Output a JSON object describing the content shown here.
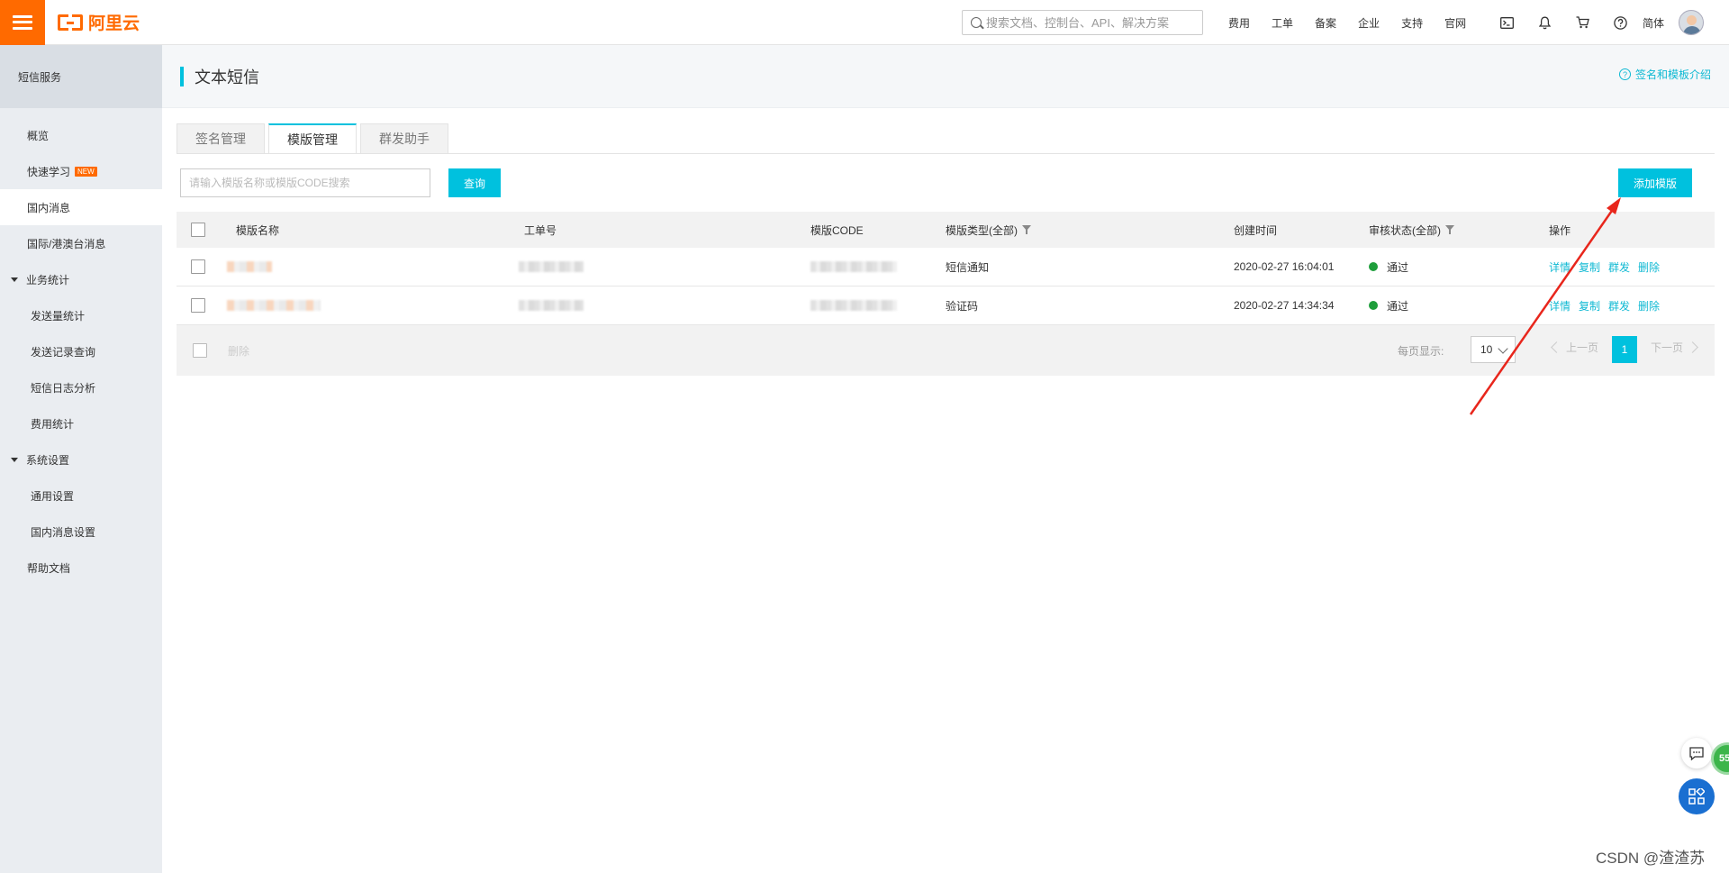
{
  "topbar": {
    "logo_text": "阿里云",
    "search_placeholder": "搜索文档、控制台、API、解决方案",
    "nav": [
      "费用",
      "工单",
      "备案",
      "企业",
      "支持",
      "官网"
    ],
    "lang": "简体",
    "icons": [
      "terminal-icon",
      "bell-icon",
      "cart-icon",
      "help-icon"
    ]
  },
  "sidebar": {
    "title": "短信服务",
    "items": [
      {
        "label": "概览",
        "type": "item"
      },
      {
        "label": "快速学习",
        "type": "item",
        "badge": "NEW"
      },
      {
        "label": "国内消息",
        "type": "item",
        "active": true
      },
      {
        "label": "国际/港澳台消息",
        "type": "item"
      },
      {
        "label": "业务统计",
        "type": "group"
      },
      {
        "label": "发送量统计",
        "type": "sub"
      },
      {
        "label": "发送记录查询",
        "type": "sub"
      },
      {
        "label": "短信日志分析",
        "type": "sub"
      },
      {
        "label": "费用统计",
        "type": "sub"
      },
      {
        "label": "系统设置",
        "type": "group"
      },
      {
        "label": "通用设置",
        "type": "sub"
      },
      {
        "label": "国内消息设置",
        "type": "sub"
      },
      {
        "label": "帮助文档",
        "type": "item"
      }
    ]
  },
  "page": {
    "title": "文本短信",
    "help_link": "签名和模板介绍",
    "tabs": [
      {
        "label": "签名管理",
        "active": false
      },
      {
        "label": "模版管理",
        "active": true
      },
      {
        "label": "群发助手",
        "active": false
      }
    ],
    "search_placeholder": "请输入模版名称或模版CODE搜索",
    "query_button": "查询",
    "add_button": "添加模版"
  },
  "table": {
    "headers": {
      "name": "模版名称",
      "order": "工单号",
      "code": "模版CODE",
      "type": "模版类型(全部)",
      "created": "创建时间",
      "status": "审核状态(全部)",
      "ops": "操作"
    },
    "rows": [
      {
        "type": "短信通知",
        "created": "2020-02-27 16:04:01",
        "status": "通过",
        "ops": [
          "详情",
          "复制",
          "群发",
          "删除"
        ]
      },
      {
        "type": "验证码",
        "created": "2020-02-27 14:34:34",
        "status": "通过",
        "ops": [
          "详情",
          "复制",
          "群发",
          "删除"
        ]
      }
    ],
    "footer": {
      "delete_label": "删除",
      "page_size_label": "每页显示:",
      "page_size": "10",
      "prev": "上一页",
      "next": "下一页",
      "current_page": "1"
    }
  },
  "floating": {
    "badge_text": "55"
  },
  "watermark": "CSDN @渣渣苏",
  "colors": {
    "brand": "#ff6a00",
    "accent": "#00c1de",
    "status_ok": "#1e9e3b",
    "annotation_arrow": "#e8261c"
  }
}
